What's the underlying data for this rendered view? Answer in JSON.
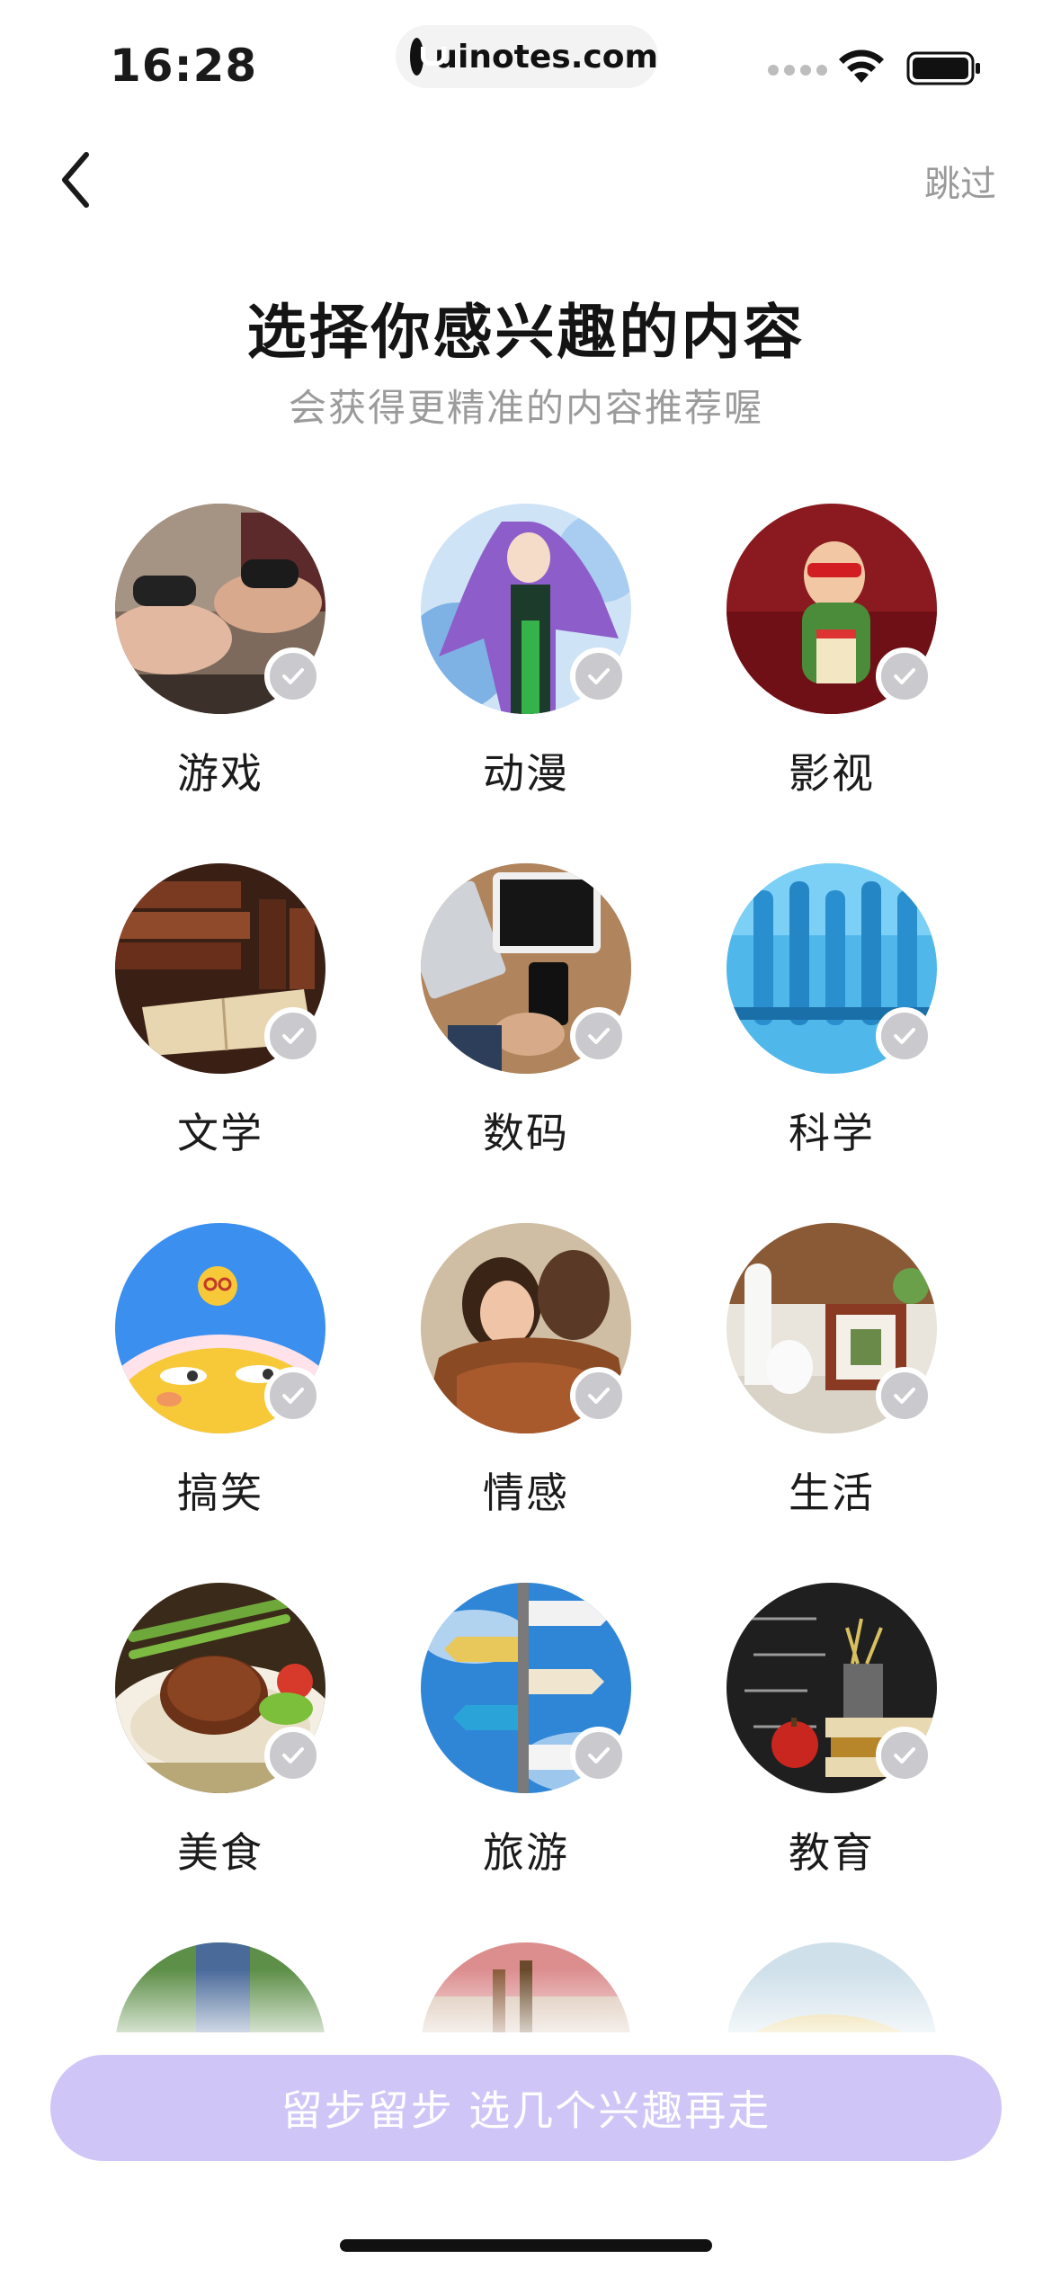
{
  "status_bar": {
    "time": "16:28",
    "url": "uinotes.com",
    "icons": [
      "signal-icon",
      "wifi-icon",
      "battery-icon"
    ]
  },
  "nav": {
    "back_icon": "chevron-left-icon",
    "skip_label": "跳过"
  },
  "header": {
    "title": "选择你感兴趣的内容",
    "subtitle": "会获得更精准的内容推荐喔"
  },
  "interests": [
    {
      "label": "游戏",
      "image": "game-controllers"
    },
    {
      "label": "动漫",
      "image": "anime-girl"
    },
    {
      "label": "影视",
      "image": "movie-kid-popcorn"
    },
    {
      "label": "文学",
      "image": "old-books"
    },
    {
      "label": "数码",
      "image": "tablet-phone"
    },
    {
      "label": "科学",
      "image": "test-tubes"
    },
    {
      "label": "搞笑",
      "image": "funny-emoji"
    },
    {
      "label": "情感",
      "image": "couple-hug"
    },
    {
      "label": "生活",
      "image": "home-decor"
    },
    {
      "label": "美食",
      "image": "steak-dish"
    },
    {
      "label": "旅游",
      "image": "signpost"
    },
    {
      "label": "教育",
      "image": "blackboard-books"
    }
  ],
  "cta": {
    "label": "留步留步 选几个兴趣再走"
  },
  "colors": {
    "accent_disabled": "#cfc6f7",
    "check_gray": "#c9c9ce",
    "subtitle_gray": "#9b9b9b"
  }
}
